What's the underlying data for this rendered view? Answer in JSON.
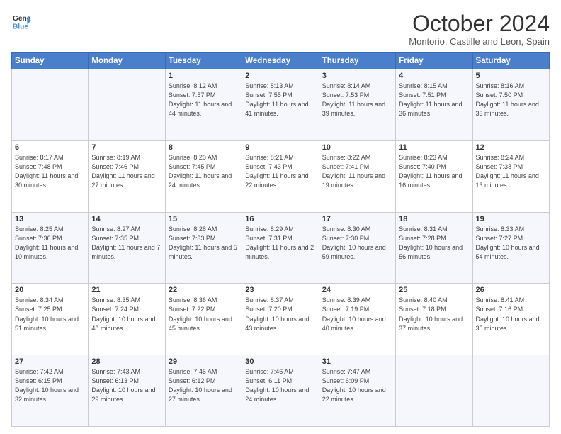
{
  "header": {
    "logo_line1": "General",
    "logo_line2": "Blue",
    "month": "October 2024",
    "location": "Montorio, Castille and Leon, Spain"
  },
  "days_of_week": [
    "Sunday",
    "Monday",
    "Tuesday",
    "Wednesday",
    "Thursday",
    "Friday",
    "Saturday"
  ],
  "weeks": [
    [
      {
        "num": "",
        "info": ""
      },
      {
        "num": "",
        "info": ""
      },
      {
        "num": "1",
        "info": "Sunrise: 8:12 AM\nSunset: 7:57 PM\nDaylight: 11 hours and 44 minutes."
      },
      {
        "num": "2",
        "info": "Sunrise: 8:13 AM\nSunset: 7:55 PM\nDaylight: 11 hours and 41 minutes."
      },
      {
        "num": "3",
        "info": "Sunrise: 8:14 AM\nSunset: 7:53 PM\nDaylight: 11 hours and 39 minutes."
      },
      {
        "num": "4",
        "info": "Sunrise: 8:15 AM\nSunset: 7:51 PM\nDaylight: 11 hours and 36 minutes."
      },
      {
        "num": "5",
        "info": "Sunrise: 8:16 AM\nSunset: 7:50 PM\nDaylight: 11 hours and 33 minutes."
      }
    ],
    [
      {
        "num": "6",
        "info": "Sunrise: 8:17 AM\nSunset: 7:48 PM\nDaylight: 11 hours and 30 minutes."
      },
      {
        "num": "7",
        "info": "Sunrise: 8:19 AM\nSunset: 7:46 PM\nDaylight: 11 hours and 27 minutes."
      },
      {
        "num": "8",
        "info": "Sunrise: 8:20 AM\nSunset: 7:45 PM\nDaylight: 11 hours and 24 minutes."
      },
      {
        "num": "9",
        "info": "Sunrise: 8:21 AM\nSunset: 7:43 PM\nDaylight: 11 hours and 22 minutes."
      },
      {
        "num": "10",
        "info": "Sunrise: 8:22 AM\nSunset: 7:41 PM\nDaylight: 11 hours and 19 minutes."
      },
      {
        "num": "11",
        "info": "Sunrise: 8:23 AM\nSunset: 7:40 PM\nDaylight: 11 hours and 16 minutes."
      },
      {
        "num": "12",
        "info": "Sunrise: 8:24 AM\nSunset: 7:38 PM\nDaylight: 11 hours and 13 minutes."
      }
    ],
    [
      {
        "num": "13",
        "info": "Sunrise: 8:25 AM\nSunset: 7:36 PM\nDaylight: 11 hours and 10 minutes."
      },
      {
        "num": "14",
        "info": "Sunrise: 8:27 AM\nSunset: 7:35 PM\nDaylight: 11 hours and 7 minutes."
      },
      {
        "num": "15",
        "info": "Sunrise: 8:28 AM\nSunset: 7:33 PM\nDaylight: 11 hours and 5 minutes."
      },
      {
        "num": "16",
        "info": "Sunrise: 8:29 AM\nSunset: 7:31 PM\nDaylight: 11 hours and 2 minutes."
      },
      {
        "num": "17",
        "info": "Sunrise: 8:30 AM\nSunset: 7:30 PM\nDaylight: 10 hours and 59 minutes."
      },
      {
        "num": "18",
        "info": "Sunrise: 8:31 AM\nSunset: 7:28 PM\nDaylight: 10 hours and 56 minutes."
      },
      {
        "num": "19",
        "info": "Sunrise: 8:33 AM\nSunset: 7:27 PM\nDaylight: 10 hours and 54 minutes."
      }
    ],
    [
      {
        "num": "20",
        "info": "Sunrise: 8:34 AM\nSunset: 7:25 PM\nDaylight: 10 hours and 51 minutes."
      },
      {
        "num": "21",
        "info": "Sunrise: 8:35 AM\nSunset: 7:24 PM\nDaylight: 10 hours and 48 minutes."
      },
      {
        "num": "22",
        "info": "Sunrise: 8:36 AM\nSunset: 7:22 PM\nDaylight: 10 hours and 45 minutes."
      },
      {
        "num": "23",
        "info": "Sunrise: 8:37 AM\nSunset: 7:20 PM\nDaylight: 10 hours and 43 minutes."
      },
      {
        "num": "24",
        "info": "Sunrise: 8:39 AM\nSunset: 7:19 PM\nDaylight: 10 hours and 40 minutes."
      },
      {
        "num": "25",
        "info": "Sunrise: 8:40 AM\nSunset: 7:18 PM\nDaylight: 10 hours and 37 minutes."
      },
      {
        "num": "26",
        "info": "Sunrise: 8:41 AM\nSunset: 7:16 PM\nDaylight: 10 hours and 35 minutes."
      }
    ],
    [
      {
        "num": "27",
        "info": "Sunrise: 7:42 AM\nSunset: 6:15 PM\nDaylight: 10 hours and 32 minutes."
      },
      {
        "num": "28",
        "info": "Sunrise: 7:43 AM\nSunset: 6:13 PM\nDaylight: 10 hours and 29 minutes."
      },
      {
        "num": "29",
        "info": "Sunrise: 7:45 AM\nSunset: 6:12 PM\nDaylight: 10 hours and 27 minutes."
      },
      {
        "num": "30",
        "info": "Sunrise: 7:46 AM\nSunset: 6:11 PM\nDaylight: 10 hours and 24 minutes."
      },
      {
        "num": "31",
        "info": "Sunrise: 7:47 AM\nSunset: 6:09 PM\nDaylight: 10 hours and 22 minutes."
      },
      {
        "num": "",
        "info": ""
      },
      {
        "num": "",
        "info": ""
      }
    ]
  ]
}
